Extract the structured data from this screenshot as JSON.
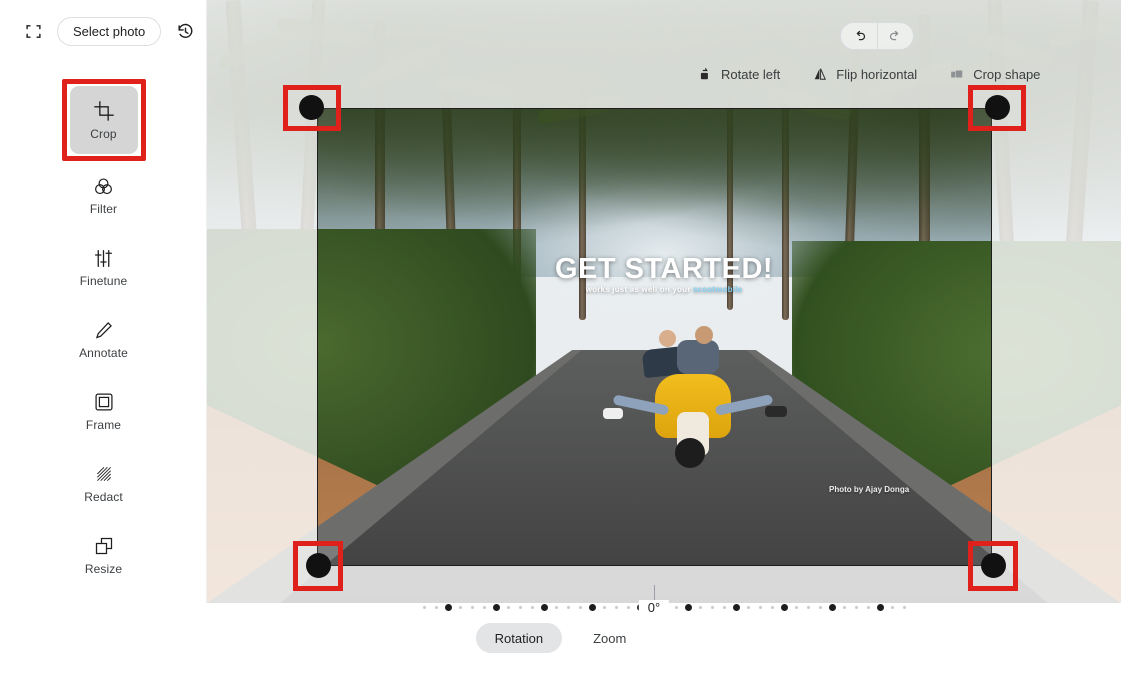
{
  "app": {
    "accent_red": "#e0201b",
    "selected_bg": "#d5d5d5",
    "canvas_bg": "#ffffff"
  },
  "header": {
    "fullscreen_icon": "expand-icon",
    "select_photo_label": "Select photo",
    "history_icon": "history-icon"
  },
  "sidebar": {
    "items": [
      {
        "label": "Crop",
        "icon": "crop-icon",
        "selected": true,
        "annotated": true
      },
      {
        "label": "Filter",
        "icon": "filter-icon",
        "selected": false,
        "annotated": false
      },
      {
        "label": "Finetune",
        "icon": "finetune-icon",
        "selected": false,
        "annotated": false
      },
      {
        "label": "Annotate",
        "icon": "pencil-icon",
        "selected": false,
        "annotated": false
      },
      {
        "label": "Frame",
        "icon": "frame-icon",
        "selected": false,
        "annotated": false
      },
      {
        "label": "Redact",
        "icon": "redact-icon",
        "selected": false,
        "annotated": false
      },
      {
        "label": "Resize",
        "icon": "resize-icon",
        "selected": false,
        "annotated": false
      }
    ]
  },
  "toolbar": {
    "undo_icon": "undo-icon",
    "redo_icon": "redo-icon",
    "options": [
      {
        "label": "Rotate left",
        "icon": "rotate-left-icon"
      },
      {
        "label": "Flip horizontal",
        "icon": "flip-horizontal-icon"
      },
      {
        "label": "Crop shape",
        "icon": "crop-shape-icon"
      }
    ]
  },
  "image": {
    "title": "GET STARTED!",
    "subtitle_pre": "works just as well on your ",
    "subtitle_mid": "scootmobile",
    "subtitle_post": " ",
    "credit": "Photo by Ajay Donga"
  },
  "crop": {
    "handles": [
      {
        "name": "crop-handle-top-left"
      },
      {
        "name": "crop-handle-top-right"
      },
      {
        "name": "crop-handle-bottom-left"
      },
      {
        "name": "crop-handle-bottom-right"
      }
    ]
  },
  "rotation": {
    "value": "0°",
    "ticks": [
      0,
      0,
      1,
      0,
      0,
      0,
      1,
      0,
      0,
      0,
      1,
      0,
      0,
      0,
      1,
      0,
      0,
      0,
      1,
      0,
      0,
      0,
      1,
      0,
      0,
      0,
      1,
      0,
      0,
      0,
      1,
      0,
      0,
      0,
      1,
      0,
      0,
      0,
      1,
      0,
      0
    ]
  },
  "bottom_tabs": [
    {
      "label": "Rotation",
      "active": true
    },
    {
      "label": "Zoom",
      "active": false
    }
  ]
}
